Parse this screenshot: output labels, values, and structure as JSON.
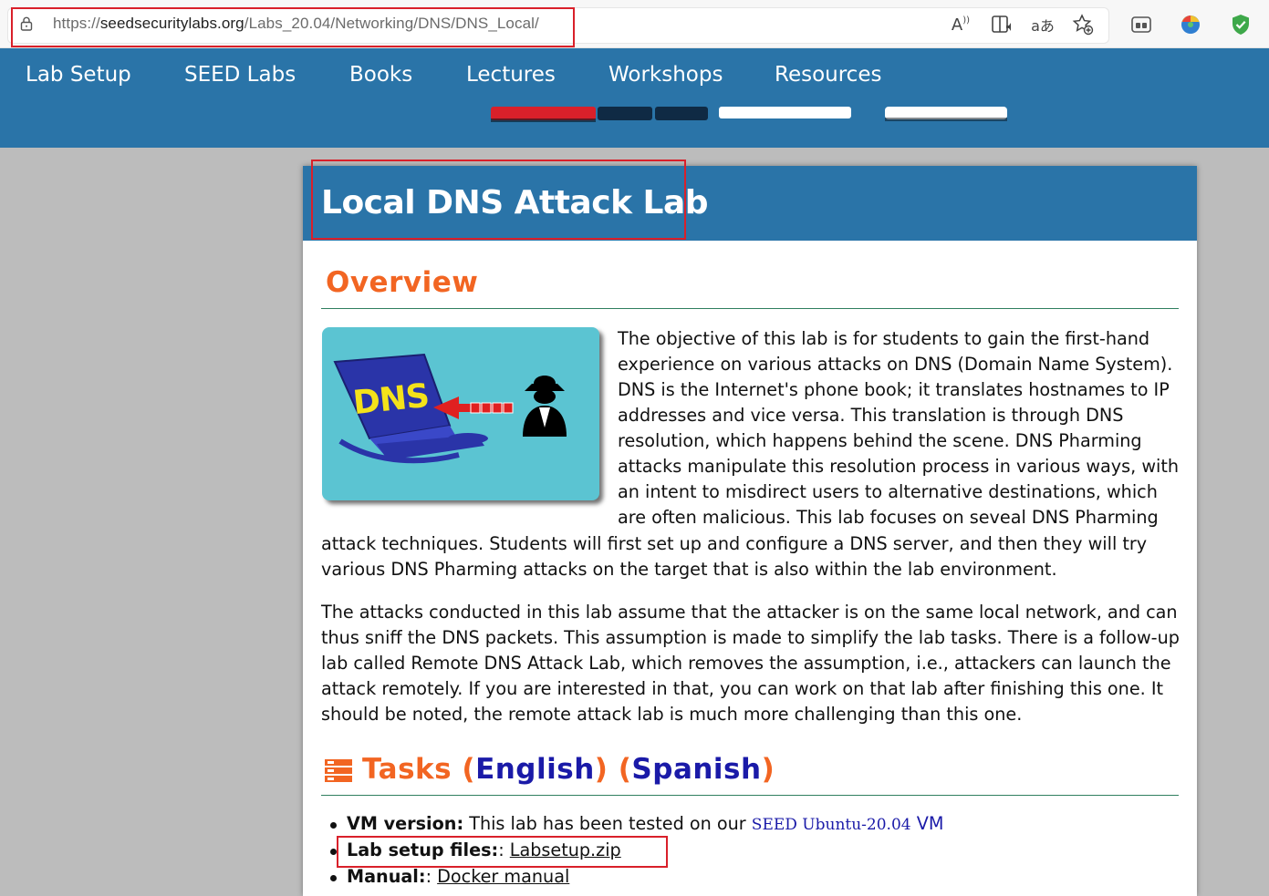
{
  "browser": {
    "url_scheme": "https://",
    "url_host": "seedsecuritylabs.org",
    "url_path": "/Labs_20.04/Networking/DNS/DNS_Local/",
    "toolbar_icons": [
      "read-aloud-icon",
      "immersive-reader-icon",
      "translate-icon",
      "add-favorite-icon",
      "collections-icon",
      "profile-icon",
      "shield-extension-icon"
    ],
    "read_aloud_glyph": "A",
    "translate_glyph": "aあ"
  },
  "nav": {
    "items": [
      "Lab Setup",
      "SEED Labs",
      "Books",
      "Lectures",
      "Workshops",
      "Resources"
    ]
  },
  "page": {
    "title": "Local DNS Attack Lab",
    "overview_heading": "Overview",
    "image_text": "DNS",
    "overview_lines": [
      "The objective of this lab is for students to gain the first-hand",
      "experience on various attacks on DNS (Domain Name System).",
      "DNS is the Internet's phone book; it translates hostnames to IP",
      "addresses and vice versa. This translation is through DNS",
      "resolution, which happens behind the scene. DNS Pharming",
      "attacks manipulate this resolution process in various ways, with",
      "an intent to misdirect users to alternative destinations, which",
      "are often malicious. This lab focuses on seveal DNS Pharming"
    ],
    "overview_wrap_lines": [
      "attack techniques. Students will first set up and configure a DNS server, and then they will try",
      "various DNS Pharming attacks on the target that is also within the lab environment."
    ],
    "assumption_lines": [
      "The attacks conducted in this lab assume that the attacker is on the same local network, and can",
      "thus sniff the DNS packets. This assumption is made to simplify the lab tasks. There is a follow-up",
      "lab called Remote DNS Attack Lab, which removes the assumption, i.e., attackers can launch the",
      "attack remotely. If you are interested in that, you can work on that lab after finishing this one. It",
      "should be noted, the remote attack lab is much more challenging than this one."
    ],
    "tasks": {
      "label": "Tasks",
      "open_paren": "(",
      "close_paren": ")",
      "english": "English",
      "spanish": "Spanish"
    },
    "bullets": {
      "vm_label": "VM version:",
      "vm_text": " This lab has been tested on our ",
      "vm_link_mono": "SEED Ubuntu-20.04",
      "vm_link_tail": " VM",
      "setup_label": "Lab setup files:",
      "setup_sep": ": ",
      "setup_link": "Labsetup.zip",
      "manual_label": "Manual:",
      "manual_sep": ": ",
      "manual_link": "Docker manual"
    }
  },
  "colors": {
    "nav_blue": "#2a74a8",
    "heading_orange": "#f26522",
    "link_blue": "#1a1aa8",
    "highlight_red": "#d9202a"
  }
}
